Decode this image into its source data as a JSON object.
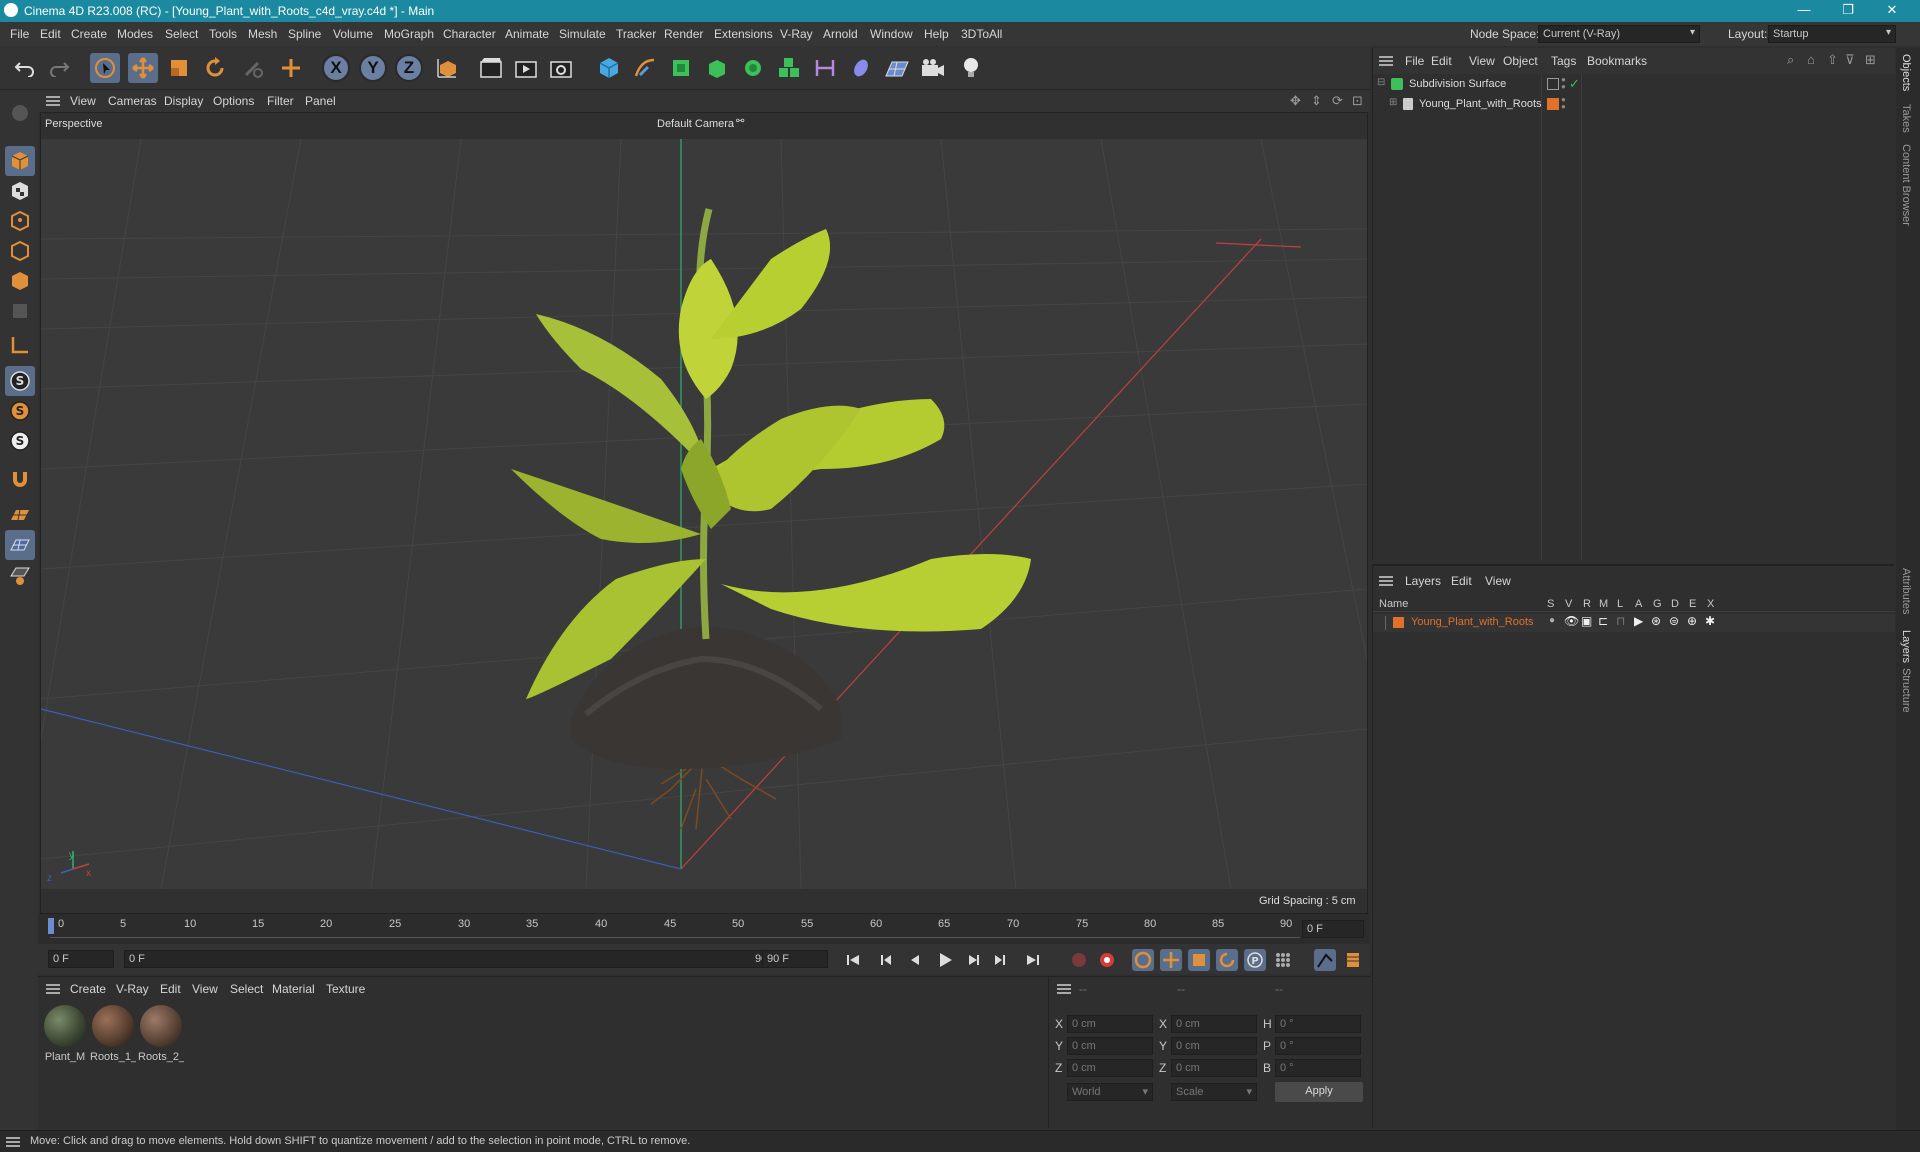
{
  "window": {
    "title": "Cinema 4D R23.008 (RC) - [Young_Plant_with_Roots_c4d_vray.c4d *] - Main",
    "minimize": "—",
    "restore": "❐",
    "close": "✕"
  },
  "menu": [
    "File",
    "Edit",
    "Create",
    "Modes",
    "Select",
    "Tools",
    "Mesh",
    "Spline",
    "Volume",
    "MoGraph",
    "Character",
    "Animate",
    "Simulate",
    "Tracker",
    "Render",
    "Extensions",
    "V-Ray",
    "Arnold",
    "Window",
    "Help",
    "3DToAll"
  ],
  "node_space": {
    "label": "Node Space:",
    "value": "Current (V-Ray)"
  },
  "layout": {
    "label": "Layout:",
    "value": "Startup"
  },
  "toolbar": {
    "axis_x": "X",
    "axis_y": "Y",
    "axis_z": "Z"
  },
  "viewport_menu": [
    "View",
    "Cameras",
    "Display",
    "Options",
    "Filter",
    "Panel"
  ],
  "viewport": {
    "projection": "Perspective",
    "camera": "Default Camera",
    "grid_spacing": "Grid Spacing : 5 cm",
    "axis_y": "y",
    "axis_x": "x",
    "axis_z": "z"
  },
  "timeline": {
    "ticks": [
      "0",
      "5",
      "10",
      "15",
      "20",
      "25",
      "30",
      "35",
      "40",
      "45",
      "50",
      "55",
      "60",
      "65",
      "70",
      "75",
      "80",
      "85",
      "90"
    ],
    "current_frame": "0 F"
  },
  "transport": {
    "start": "0 F",
    "range_start": "0 F",
    "range_end": "90 F",
    "end": "90 F"
  },
  "material_menu": [
    "Create",
    "V-Ray",
    "Edit",
    "View",
    "Select",
    "Material",
    "Texture"
  ],
  "materials": [
    {
      "name": "Plant_M",
      "color": "#3f4a35"
    },
    {
      "name": "Roots_1_",
      "color": "#5a4030"
    },
    {
      "name": "Roots_2_",
      "color": "#5c4436"
    }
  ],
  "coords": {
    "header": [
      "--",
      "--",
      "--"
    ],
    "rows": [
      {
        "a": "X",
        "v1": "0 cm",
        "b": "X",
        "v2": "0 cm",
        "c": "H",
        "v3": "0 °"
      },
      {
        "a": "Y",
        "v1": "0 cm",
        "b": "Y",
        "v2": "0 cm",
        "c": "P",
        "v3": "0 °"
      },
      {
        "a": "Z",
        "v1": "0 cm",
        "b": "Z",
        "v2": "0 cm",
        "c": "B",
        "v3": "0 °"
      }
    ],
    "world": "World",
    "scale": "Scale",
    "apply": "Apply"
  },
  "object_menu": [
    "File",
    "Edit",
    "View",
    "Object",
    "Tags",
    "Bookmarks"
  ],
  "objects": [
    {
      "name": "Subdivision Surface"
    },
    {
      "name": "Young_Plant_with_Roots"
    }
  ],
  "layers_menu": [
    "Layers",
    "Edit",
    "View"
  ],
  "layers_header": {
    "name": "Name",
    "cols": [
      "S",
      "V",
      "R",
      "M",
      "L",
      "A",
      "G",
      "D",
      "E",
      "X"
    ]
  },
  "layers": [
    {
      "name": "Young_Plant_with_Roots",
      "color": "#e0702a"
    }
  ],
  "right_tabs": [
    "Objects",
    "Takes",
    "Content Browser",
    "Attributes",
    "Layers",
    "Structure"
  ],
  "status": "Move: Click and drag to move elements. Hold down SHIFT to quantize movement / add to the selection in point mode, CTRL to remove.",
  "colors": {
    "accent": "#1b8aa0",
    "selected": "#5a6d8a",
    "orange": "#e0702a"
  }
}
